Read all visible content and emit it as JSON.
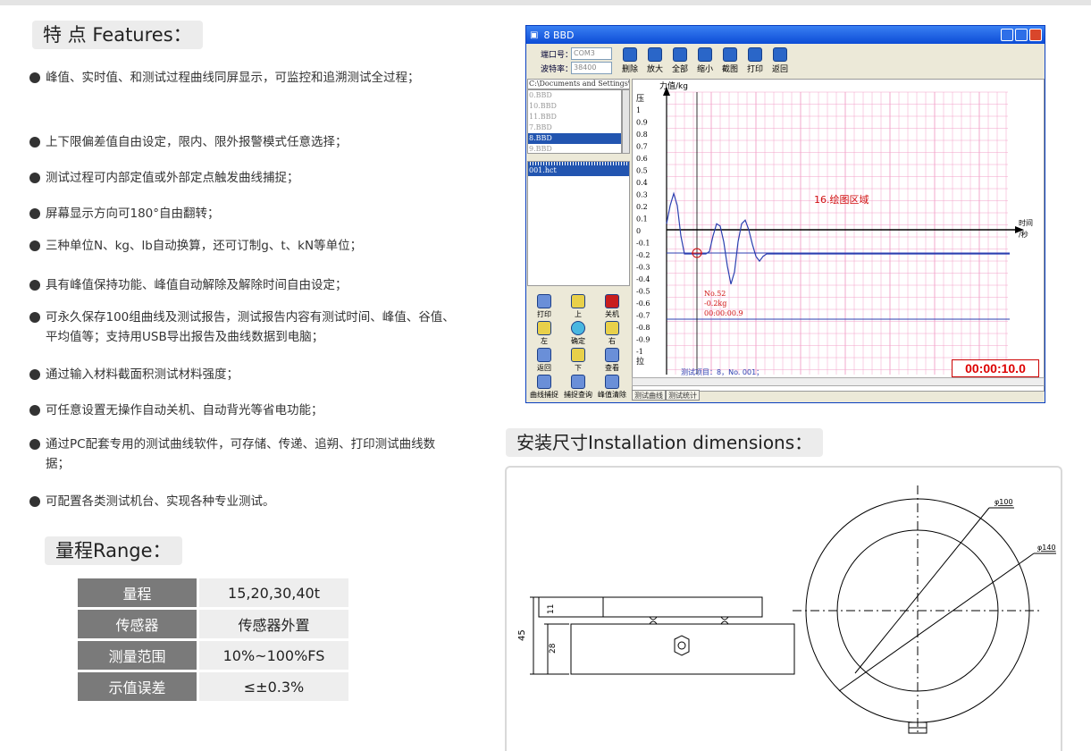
{
  "features": {
    "title": "特 点 Features：",
    "items": [
      "峰值、实时值、和测试过程曲线同屏显示，可监控和追溯测试全过程；",
      "上下限偏差值自由设定，限内、限外报警模式任意选择；",
      "测试过程可内部定值或外部定点触发曲线捕捉；",
      "屏幕显示方向可180°自由翻转；",
      "三种单位N、kg、lb自动换算，还可订制g、t、kN等单位；",
      "具有峰值保持功能、峰值自动解除及解除时间自由设定；",
      "可永久保存100组曲线及测试报告，测试报告内容有测试时间、峰值、谷值、平均值等；支持用USB导出报告及曲线数据到电脑；",
      "通过输入材料截面积测试材料强度；",
      "可任意设置无操作自动关机、自动背光等省电功能；",
      "通过PC配套专用的测试曲线软件，可存储、传递、追朔、打印测试曲线数据；",
      "可配置各类测试机台、实现各种专业测试。"
    ]
  },
  "range": {
    "title": "量程Range：",
    "rows": [
      {
        "k": "量程",
        "v": "15,20,30,40t"
      },
      {
        "k": "传感器",
        "v": "传感器外置"
      },
      {
        "k": "测量范围",
        "v": "10%~100%FS"
      },
      {
        "k": "示值误差",
        "v": "≤±0.3%"
      }
    ]
  },
  "software": {
    "window_title": "8 BBD",
    "port_label": "端口号：",
    "port_value": "COM3",
    "baud_label": "波特率：",
    "baud_value": "38400",
    "tools": [
      "删除",
      "放大",
      "全部",
      "缩小",
      "截图",
      "打印",
      "返回"
    ],
    "file_path": "C:\\Documents and Settings\\Admi",
    "files": [
      "0.BBD",
      "10.BBD",
      "11.BBD",
      "7.BBD",
      "8.BBD",
      "9.BBD"
    ],
    "selected_file": "8.BBD",
    "report_file": "001.hct",
    "keys": [
      "打印",
      "上",
      "关机",
      "左",
      "确定",
      "右",
      "返回",
      "下",
      "查看",
      "曲线捕捉",
      "捕捉查询",
      "峰值清除"
    ],
    "bottom_tabs": [
      "测试曲线",
      "测试统计"
    ],
    "y_axis_label": "力值/kg",
    "y_top_label": "压",
    "y_bottom_label": "拉",
    "y_ticks": [
      "1",
      "0.9",
      "0.8",
      "0.7",
      "0.6",
      "0.5",
      "0.4",
      "0.3",
      "0.2",
      "0.1",
      "0",
      "-0.1",
      "-0.2",
      "-0.3",
      "-0.4",
      "-0.5",
      "-0.6",
      "-0.7",
      "-0.8",
      "-0.9",
      "-1"
    ],
    "x_axis_label_1": "时间",
    "x_axis_label_2": "/秒",
    "plot_area_label": "16.绘图区域",
    "marker_no": "No.52",
    "marker_value": "-0.2kg",
    "marker_time": "00:00:00.9",
    "test_item": "测试项目：8，No. 001；",
    "elapsed_time": "00:00:10.0",
    "colors": {
      "curve": "#2b3fb0",
      "grid": "#f2a0c8",
      "marker": "#d01010"
    }
  },
  "install": {
    "title": "安装尺寸Installation dimensions：",
    "dims": {
      "inner_dia": "φ100",
      "outer_dia": "φ140",
      "height": "45",
      "top": "11",
      "body": "28"
    }
  }
}
